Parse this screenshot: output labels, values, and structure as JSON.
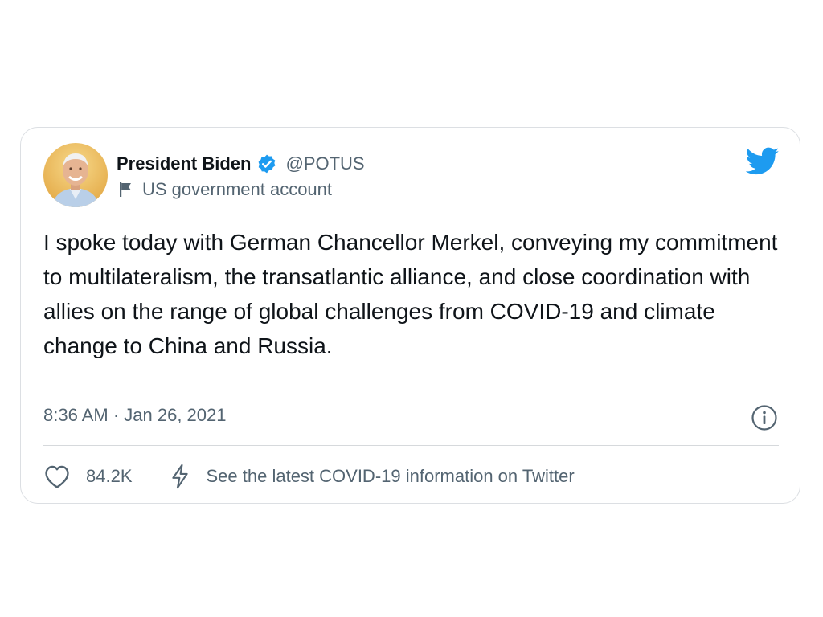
{
  "tweet": {
    "author": {
      "display_name": "President Biden",
      "handle": "@POTUS",
      "verified": true,
      "label": "US government account",
      "avatar_icon": "person-avatar",
      "label_icon": "flag-icon"
    },
    "text": "I spoke today with German Chancellor Merkel, conveying my commitment to multilateralism, the transatlantic alliance, and close coordination with allies on the range of global challenges from COVID-19 and climate change to China and Russia.",
    "timestamp": "8:36 AM · Jan 26, 2021",
    "likes": "84.2K",
    "covid_link_text": "See the latest COVID-19 information on Twitter",
    "icons": {
      "brand": "twitter-bird-icon",
      "verified": "verified-badge-icon",
      "info": "info-icon",
      "like": "heart-icon",
      "covid": "lightning-bolt-icon"
    }
  },
  "colors": {
    "brand_blue": "#1d9bf0",
    "text_primary": "#0f1419",
    "text_secondary": "#536471",
    "border": "#dcdfe3"
  }
}
